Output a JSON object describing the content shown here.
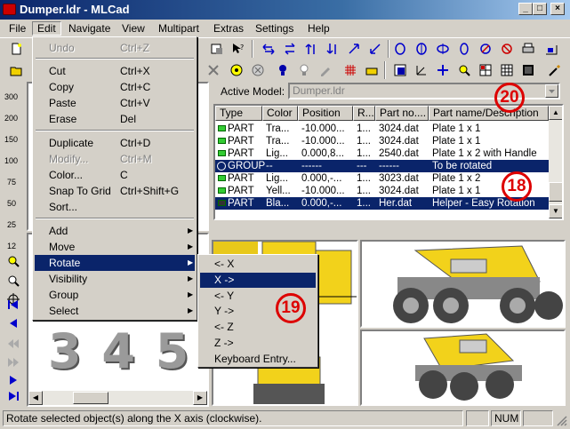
{
  "window": {
    "title": "Dumper.ldr - MLCad",
    "min": "_",
    "max": "□",
    "close": "×"
  },
  "menubar": [
    "File",
    "Edit",
    "Navigate",
    "View",
    "Multipart",
    "Extras",
    "Settings",
    "Help"
  ],
  "left_toolbar": {
    "zoom_levels": [
      "300",
      "200",
      "150",
      "100",
      "75",
      "50",
      "25",
      "12"
    ]
  },
  "model": {
    "label": "Active Model:",
    "value": "Dumper.ldr"
  },
  "list": {
    "columns": [
      "Type",
      "Color",
      "Position",
      "R...",
      "Part no....",
      "Part name/Description"
    ],
    "rows": [
      {
        "type": "PART",
        "color": "Tra...",
        "position": "-10.000...",
        "r": "1...",
        "part": "3024.dat",
        "desc": "Plate  1 x 1"
      },
      {
        "type": "PART",
        "color": "Tra...",
        "position": "-10.000...",
        "r": "1...",
        "part": "3024.dat",
        "desc": "Plate  1 x 1"
      },
      {
        "type": "PART",
        "color": "Lig...",
        "position": "0.000,8...",
        "r": "1...",
        "part": "2540.dat",
        "desc": "Plate  1 x 2 with Handle"
      },
      {
        "type": "GROUP",
        "color": "--",
        "position": "------",
        "r": "---",
        "part": "------",
        "desc": "To be rotated"
      },
      {
        "type": "PART",
        "color": "Lig...",
        "position": "0.000,-...",
        "r": "1...",
        "part": "3023.dat",
        "desc": "Plate  1 x 2"
      },
      {
        "type": "PART",
        "color": "Yell...",
        "position": "-10.000...",
        "r": "1...",
        "part": "3024.dat",
        "desc": "Plate  1 x 1"
      },
      {
        "type": "PART",
        "color": "Bla...",
        "position": "0.000,-...",
        "r": "1...",
        "part": "Her.dat",
        "desc": "Helper - Easy Rotation"
      }
    ]
  },
  "edit_menu": {
    "items": [
      {
        "label": "Undo",
        "shortcut": "Ctrl+Z",
        "disabled": true
      },
      {
        "label": "Cut",
        "shortcut": "Ctrl+X"
      },
      {
        "label": "Copy",
        "shortcut": "Ctrl+C"
      },
      {
        "label": "Paste",
        "shortcut": "Ctrl+V"
      },
      {
        "label": "Erase",
        "shortcut": "Del"
      },
      {
        "label": "Duplicate",
        "shortcut": "Ctrl+D"
      },
      {
        "label": "Modify...",
        "shortcut": "Ctrl+M",
        "disabled": true
      },
      {
        "label": "Color...",
        "shortcut": "C"
      },
      {
        "label": "Snap To Grid",
        "shortcut": "Ctrl+Shift+G"
      },
      {
        "label": "Sort..."
      },
      {
        "label": "Add"
      },
      {
        "label": "Move"
      },
      {
        "label": "Rotate"
      },
      {
        "label": "Visibility"
      },
      {
        "label": "Group"
      },
      {
        "label": "Select"
      }
    ]
  },
  "rotate_menu": {
    "items": [
      "<- X",
      "X ->",
      "<- Y",
      "Y ->",
      "<- Z",
      "Z ->",
      "Keyboard Entry..."
    ]
  },
  "callouts": {
    "c18": "18",
    "c19": "19",
    "c20": "20"
  },
  "preview_digits": "3 4 5",
  "status": {
    "text": "Rotate selected object(s) along the X axis (clockwise).",
    "num": "NUM"
  },
  "colors": {
    "title_start": "#0a246a",
    "title_end": "#a6caf0",
    "selection": "#0a246a",
    "callout": "#dd0000",
    "lego_yellow": "#f2d21b",
    "lego_gray": "#8a8a8a"
  },
  "icons": [
    "app-icon",
    "new-icon",
    "open-icon",
    "save-icon",
    "zoom-icon",
    "rotate-left-icon",
    "rotate-right-icon",
    "play-icon",
    "stop-icon",
    "lightbulb-icon",
    "grid-icon",
    "nav-first-icon",
    "nav-prev-icon",
    "nav-next-icon",
    "nav-last-icon"
  ]
}
